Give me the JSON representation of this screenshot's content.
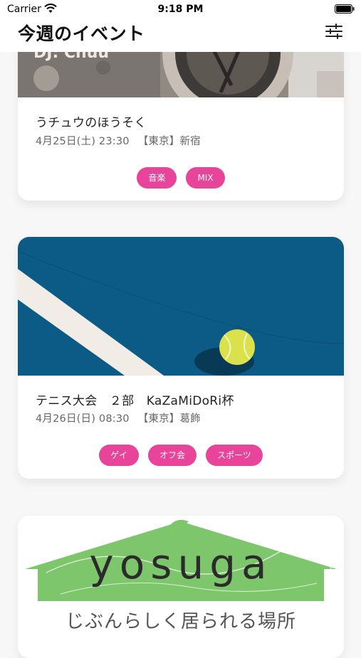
{
  "status_bar": {
    "carrier": "Carrier",
    "time": "9:18 PM"
  },
  "header": {
    "title": "今週のイベント"
  },
  "events": [
    {
      "banner_text": "DJ: Chuu",
      "title": "うチュウのほうそく",
      "date": "4月25日(土) 23:30",
      "location": "【東京】新宿",
      "tags": [
        "音楽",
        "MIX"
      ]
    },
    {
      "title": "テニス大会　２部　KaZaMiDoRi杯",
      "date": "4月26日(日) 08:30",
      "location": "【東京】葛飾",
      "tags": [
        "ゲイ",
        "オフ会",
        "スポーツ"
      ]
    },
    {
      "logo_text": "yosuga",
      "tagline": "じぶんらしく居られる場所"
    }
  ],
  "colors": {
    "tag": "#e8449a",
    "court": "#0c5b86",
    "logo_green": "#7dc66b"
  }
}
